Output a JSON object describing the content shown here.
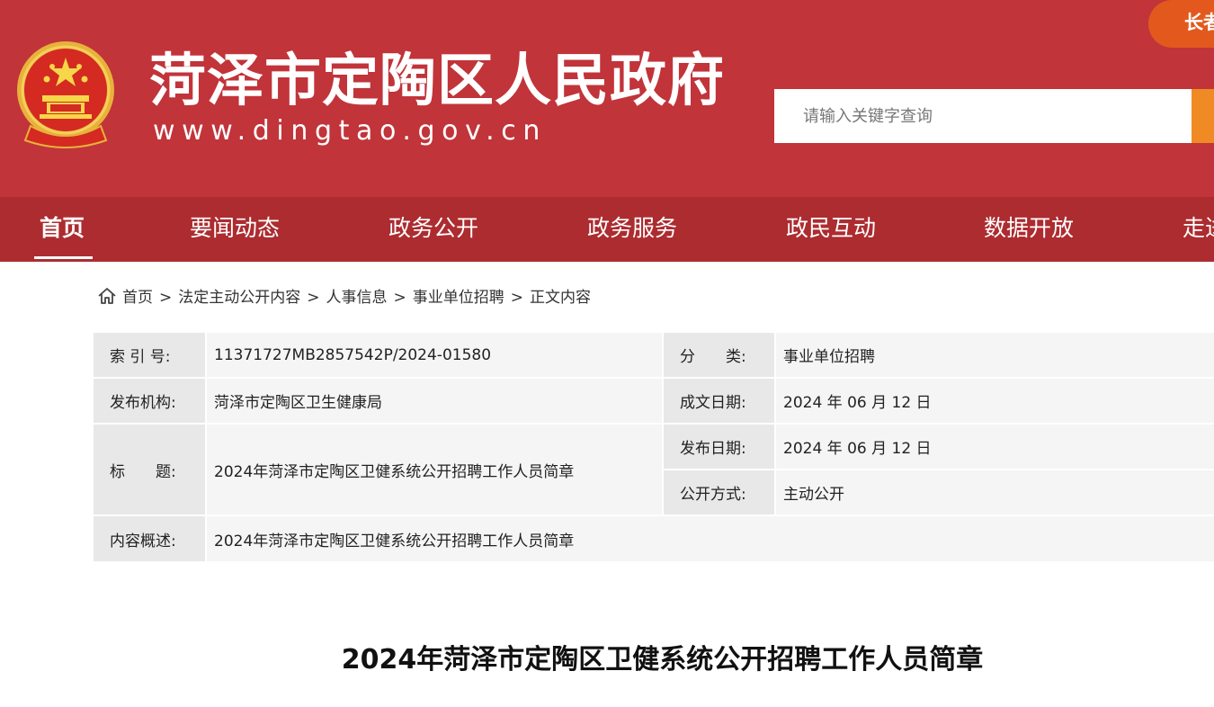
{
  "header": {
    "site_name": "菏泽市定陶区人民政府",
    "site_url": "www.dingtao.gov.cn",
    "elder_mode": "长者",
    "search_placeholder": "请输入关键字查询",
    "colors": {
      "header_bg": "#c1343a",
      "nav_bg": "#ac2c30",
      "search_button": "#f08a24",
      "elder_pill": "#e3591d"
    }
  },
  "nav": {
    "items": [
      "首页",
      "要闻动态",
      "政务公开",
      "政务服务",
      "政民互动",
      "数据开放",
      "走进"
    ],
    "active": "首页"
  },
  "breadcrumb": {
    "items": [
      "首页",
      "法定主动公开内容",
      "人事信息",
      "事业单位招聘",
      "正文内容"
    ],
    "separator": ">"
  },
  "info": {
    "index_label": "索 引 号:",
    "index_value": "11371727MB2857542P/2024-01580",
    "category_label": "分　　类:",
    "category_value": "事业单位招聘",
    "publisher_label": "发布机构:",
    "publisher_value": "菏泽市定陶区卫生健康局",
    "written_date_label": "成文日期:",
    "written_date_value": "2024 年 06 月 12 日",
    "title_label": "标　　题:",
    "title_value": "2024年菏泽市定陶区卫健系统公开招聘工作人员简章",
    "publish_date_label": "发布日期:",
    "publish_date_value": "2024 年 06 月 12 日",
    "disclosure_label": "公开方式:",
    "disclosure_value": "主动公开",
    "summary_label": "内容概述:",
    "summary_value": "2024年菏泽市定陶区卫健系统公开招聘工作人员简章"
  },
  "article": {
    "title": "2024年菏泽市定陶区卫健系统公开招聘工作人员简章"
  }
}
